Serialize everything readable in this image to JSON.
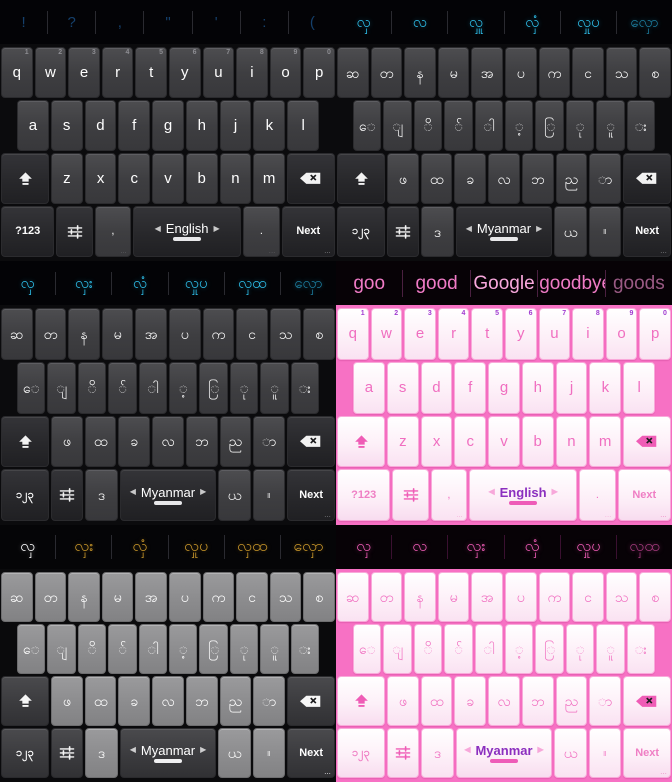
{
  "panels": [
    {
      "id": "dark-english",
      "theme": "dark",
      "suggestion_kind": "punctuation",
      "suggestions": [
        "!",
        "?",
        ",",
        "\"",
        "'",
        ":",
        "("
      ],
      "rows": [
        [
          {
            "label": "q",
            "hint": "1"
          },
          {
            "label": "w",
            "hint": "2"
          },
          {
            "label": "e",
            "hint": "3"
          },
          {
            "label": "r",
            "hint": "4"
          },
          {
            "label": "t",
            "hint": "5"
          },
          {
            "label": "y",
            "hint": "6"
          },
          {
            "label": "u",
            "hint": "7"
          },
          {
            "label": "i",
            "hint": "8"
          },
          {
            "label": "o",
            "hint": "9"
          },
          {
            "label": "p",
            "hint": "0"
          }
        ],
        [
          {
            "label": "a"
          },
          {
            "label": "s"
          },
          {
            "label": "d"
          },
          {
            "label": "f"
          },
          {
            "label": "g"
          },
          {
            "label": "h"
          },
          {
            "label": "j"
          },
          {
            "label": "k"
          },
          {
            "label": "l"
          }
        ],
        [
          {
            "icon": "shift-icon",
            "name": "shift-key"
          },
          {
            "label": "z"
          },
          {
            "label": "x"
          },
          {
            "label": "c"
          },
          {
            "label": "v"
          },
          {
            "label": "b"
          },
          {
            "label": "n"
          },
          {
            "label": "m"
          },
          {
            "icon": "delete-icon",
            "name": "delete-key"
          }
        ],
        [
          {
            "label": "?123",
            "name": "symbols-key"
          },
          {
            "icon": "settings-icon",
            "name": "settings-key"
          },
          {
            "label": ",",
            "name": "comma-key",
            "dots": "..."
          },
          {
            "label": "English",
            "name": "space-language-key",
            "type": "space"
          },
          {
            "label": ".",
            "name": "period-key",
            "dots": "..."
          },
          {
            "label": "Next",
            "name": "next-key",
            "dots": "..."
          }
        ]
      ]
    },
    {
      "id": "dark-myanmar",
      "theme": "dark",
      "suggestion_kind": "cyan",
      "suggestions": [
        "လှ",
        "လ",
        "လှူ",
        "လှံ",
        "လှုပ",
        "လှော"
      ],
      "rows": [
        [
          {
            "label": "ဆ"
          },
          {
            "label": "တ"
          },
          {
            "label": "န"
          },
          {
            "label": "မ"
          },
          {
            "label": "အ"
          },
          {
            "label": "ပ"
          },
          {
            "label": "က"
          },
          {
            "label": "င"
          },
          {
            "label": "သ"
          },
          {
            "label": "စ"
          }
        ],
        [
          {
            "label": "ေ"
          },
          {
            "label": "ျ"
          },
          {
            "label": "ိ"
          },
          {
            "label": "်"
          },
          {
            "label": "ါ"
          },
          {
            "label": "့"
          },
          {
            "label": "ြ"
          },
          {
            "label": "ု"
          },
          {
            "label": "ူ"
          },
          {
            "label": "း"
          }
        ],
        [
          {
            "icon": "shift-icon",
            "name": "shift-key"
          },
          {
            "label": "ဖ"
          },
          {
            "label": "ထ"
          },
          {
            "label": "ခ"
          },
          {
            "label": "လ"
          },
          {
            "label": "ဘ"
          },
          {
            "label": "ည"
          },
          {
            "label": "ာ"
          },
          {
            "icon": "delete-icon",
            "name": "delete-key"
          }
        ],
        [
          {
            "label": "၁၂၃",
            "name": "symbols-key"
          },
          {
            "icon": "settings-icon",
            "name": "settings-key"
          },
          {
            "label": "ဒ",
            "name": "extra-key"
          },
          {
            "label": "Myanmar",
            "name": "space-language-key",
            "type": "space"
          },
          {
            "label": "ယ",
            "name": "ya-key"
          },
          {
            "label": "။",
            "name": "period-key"
          },
          {
            "label": "Next",
            "name": "next-key",
            "dots": "..."
          }
        ]
      ]
    },
    {
      "id": "dark-myanmar-alt",
      "theme": "dark",
      "suggestion_kind": "cyan",
      "suggestions": [
        "လှ",
        "လှး",
        "လှံ",
        "လှုပ",
        "လှထ",
        "လှော"
      ],
      "rows": [
        [
          {
            "label": "ဆ"
          },
          {
            "label": "တ"
          },
          {
            "label": "န"
          },
          {
            "label": "မ"
          },
          {
            "label": "အ"
          },
          {
            "label": "ပ"
          },
          {
            "label": "က"
          },
          {
            "label": "င"
          },
          {
            "label": "သ"
          },
          {
            "label": "စ"
          }
        ],
        [
          {
            "label": "ေ"
          },
          {
            "label": "ျ"
          },
          {
            "label": "ိ"
          },
          {
            "label": "်"
          },
          {
            "label": "ါ"
          },
          {
            "label": "့"
          },
          {
            "label": "ြ"
          },
          {
            "label": "ု"
          },
          {
            "label": "ူ"
          },
          {
            "label": "း"
          }
        ],
        [
          {
            "icon": "shift-icon",
            "name": "shift-key"
          },
          {
            "label": "ဖ"
          },
          {
            "label": "ထ"
          },
          {
            "label": "ခ"
          },
          {
            "label": "လ"
          },
          {
            "label": "ဘ"
          },
          {
            "label": "ည"
          },
          {
            "label": "ာ"
          },
          {
            "icon": "delete-icon",
            "name": "delete-key"
          }
        ],
        [
          {
            "label": "၁၂၃",
            "name": "symbols-key"
          },
          {
            "icon": "settings-icon",
            "name": "settings-key"
          },
          {
            "label": "ဒ",
            "name": "extra-key"
          },
          {
            "label": "Myanmar",
            "name": "space-language-key",
            "type": "space"
          },
          {
            "label": "ယ",
            "name": "ya-key"
          },
          {
            "label": "။",
            "name": "period-key"
          },
          {
            "label": "Next",
            "name": "next-key",
            "dots": "..."
          }
        ]
      ]
    },
    {
      "id": "pink-english",
      "theme": "pink",
      "suggestion_kind": "english",
      "suggestions": [
        "goo",
        "good",
        "Google",
        "goodbye",
        "goods"
      ],
      "rows": [
        [
          {
            "label": "q",
            "hint": "1"
          },
          {
            "label": "w",
            "hint": "2"
          },
          {
            "label": "e",
            "hint": "3"
          },
          {
            "label": "r",
            "hint": "4"
          },
          {
            "label": "t",
            "hint": "5"
          },
          {
            "label": "y",
            "hint": "6"
          },
          {
            "label": "u",
            "hint": "7"
          },
          {
            "label": "i",
            "hint": "8"
          },
          {
            "label": "o",
            "hint": "9"
          },
          {
            "label": "p",
            "hint": "0"
          }
        ],
        [
          {
            "label": "a"
          },
          {
            "label": "s"
          },
          {
            "label": "d"
          },
          {
            "label": "f"
          },
          {
            "label": "g"
          },
          {
            "label": "h"
          },
          {
            "label": "j"
          },
          {
            "label": "k"
          },
          {
            "label": "l"
          }
        ],
        [
          {
            "icon": "shift-icon",
            "name": "shift-key"
          },
          {
            "label": "z"
          },
          {
            "label": "x"
          },
          {
            "label": "c"
          },
          {
            "label": "v"
          },
          {
            "label": "b"
          },
          {
            "label": "n"
          },
          {
            "label": "m"
          },
          {
            "icon": "delete-icon",
            "name": "delete-key"
          }
        ],
        [
          {
            "label": "?123",
            "name": "symbols-key"
          },
          {
            "icon": "settings-icon",
            "name": "settings-key"
          },
          {
            "label": ",",
            "name": "comma-key",
            "dots": "..."
          },
          {
            "label": "English",
            "name": "space-language-key",
            "type": "space"
          },
          {
            "label": ".",
            "name": "period-key",
            "dots": "..."
          },
          {
            "label": "Next",
            "name": "next-key",
            "dots": "..."
          }
        ]
      ]
    },
    {
      "id": "gray-myanmar",
      "theme": "gray",
      "suggestion_kind": "gold",
      "suggestions": [
        "လှ",
        "လှး",
        "လှံ",
        "လှုပ",
        "လှထ",
        "လှော"
      ],
      "rows": [
        [
          {
            "label": "ဆ"
          },
          {
            "label": "တ"
          },
          {
            "label": "န"
          },
          {
            "label": "မ"
          },
          {
            "label": "အ"
          },
          {
            "label": "ပ"
          },
          {
            "label": "က"
          },
          {
            "label": "င"
          },
          {
            "label": "သ"
          },
          {
            "label": "စ"
          }
        ],
        [
          {
            "label": "ေ"
          },
          {
            "label": "ျ"
          },
          {
            "label": "ိ"
          },
          {
            "label": "်"
          },
          {
            "label": "ါ"
          },
          {
            "label": "့"
          },
          {
            "label": "ြ"
          },
          {
            "label": "ု"
          },
          {
            "label": "ူ"
          },
          {
            "label": "း"
          }
        ],
        [
          {
            "icon": "shift-icon",
            "name": "shift-key"
          },
          {
            "label": "ဖ"
          },
          {
            "label": "ထ"
          },
          {
            "label": "ခ"
          },
          {
            "label": "လ"
          },
          {
            "label": "ဘ"
          },
          {
            "label": "ည"
          },
          {
            "label": "ာ"
          },
          {
            "icon": "delete-icon",
            "name": "delete-key"
          }
        ],
        [
          {
            "label": "၁၂၃",
            "name": "symbols-key"
          },
          {
            "icon": "settings-icon",
            "name": "settings-key"
          },
          {
            "label": "ဒ",
            "name": "extra-key"
          },
          {
            "label": "Myanmar",
            "name": "space-language-key",
            "type": "space"
          },
          {
            "label": "ယ",
            "name": "ya-key"
          },
          {
            "label": "။",
            "name": "period-key"
          },
          {
            "label": "Next",
            "name": "next-key",
            "dots": "..."
          }
        ]
      ]
    },
    {
      "id": "pink-myanmar",
      "theme": "pink",
      "suggestion_kind": "pink-myanmar",
      "suggestions": [
        "လှ",
        "လ",
        "လှး",
        "လှံ",
        "လှုပ",
        "လှထ"
      ],
      "rows": [
        [
          {
            "label": "ဆ"
          },
          {
            "label": "တ"
          },
          {
            "label": "န"
          },
          {
            "label": "မ"
          },
          {
            "label": "အ"
          },
          {
            "label": "ပ"
          },
          {
            "label": "က"
          },
          {
            "label": "င"
          },
          {
            "label": "သ"
          },
          {
            "label": "စ"
          }
        ],
        [
          {
            "label": "ေ"
          },
          {
            "label": "ျ"
          },
          {
            "label": "ိ"
          },
          {
            "label": "်"
          },
          {
            "label": "ါ"
          },
          {
            "label": "့"
          },
          {
            "label": "ြ"
          },
          {
            "label": "ု"
          },
          {
            "label": "ူ"
          },
          {
            "label": "း"
          }
        ],
        [
          {
            "icon": "shift-icon",
            "name": "shift-key"
          },
          {
            "label": "ဖ"
          },
          {
            "label": "ထ"
          },
          {
            "label": "ခ"
          },
          {
            "label": "လ"
          },
          {
            "label": "ဘ"
          },
          {
            "label": "ည"
          },
          {
            "label": "ာ"
          },
          {
            "icon": "delete-icon",
            "name": "delete-key"
          }
        ],
        [
          {
            "label": "၁၂၃",
            "name": "symbols-key"
          },
          {
            "icon": "settings-icon",
            "name": "settings-key"
          },
          {
            "label": "ဒ",
            "name": "extra-key"
          },
          {
            "label": "Myanmar",
            "name": "space-language-key",
            "type": "space"
          },
          {
            "label": "ယ",
            "name": "ya-key"
          },
          {
            "label": "။",
            "name": "period-key"
          },
          {
            "label": "Next",
            "name": "next-key",
            "dots": "..."
          }
        ]
      ]
    }
  ],
  "colors": {
    "dark_key": "#3e3e41",
    "gray_key": "#8c8c8e",
    "pink_bg": "#f771c4",
    "pink_key": "#fdf0f8",
    "pink_text": "#f06ec0",
    "cyan_suggestion": "#2fc3ef",
    "gold_suggestion": "#c8962a",
    "purple_hint": "#a03bd0"
  }
}
